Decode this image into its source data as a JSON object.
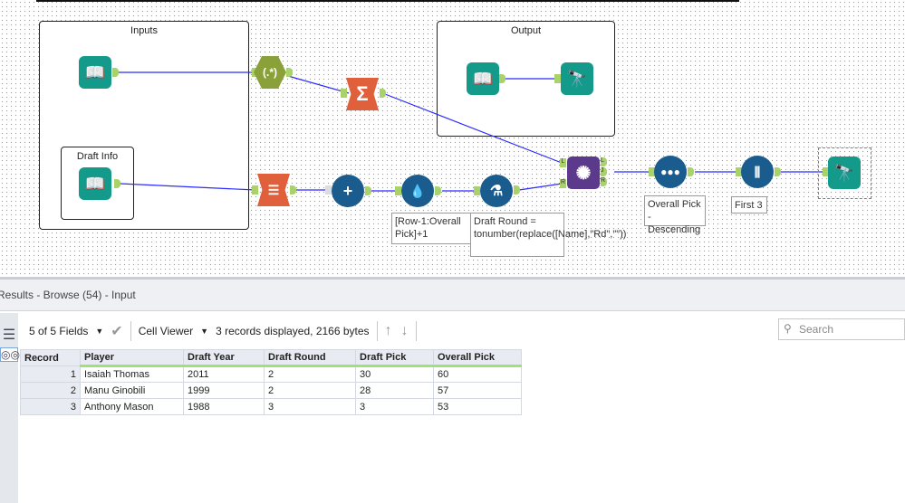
{
  "canvas": {
    "containers": {
      "inputs": "Inputs",
      "output": "Output",
      "draft_info": "Draft Info"
    },
    "tools": {
      "regex": "(.*)",
      "summarize": "Σ",
      "join_left": "L",
      "join_right": "R",
      "join_out_l": "L",
      "join_out_j": "J",
      "join_out_r": "R"
    },
    "annotations": {
      "multirow": "[Row-1:Overall Pick]+1",
      "formula": "Draft Round = tonumber(replace([Name],\"Rd\",\"\"))",
      "sort": "Overall Pick - Descending",
      "sample": "First 3"
    },
    "wire_color": "#2b2bff"
  },
  "results": {
    "title": "Results - Browse (54) - Input",
    "fields": "5 of 5 Fields",
    "viewer": "Cell Viewer",
    "status": "3 records displayed, 2166 bytes",
    "search_placeholder": "Search",
    "columns": [
      "Record",
      "Player",
      "Draft Year",
      "Draft Round",
      "Draft Pick",
      "Overall Pick"
    ],
    "rows": [
      [
        "1",
        "Isaiah Thomas",
        "2011",
        "2",
        "30",
        "60"
      ],
      [
        "2",
        "Manu Ginobili",
        "1999",
        "2",
        "28",
        "57"
      ],
      [
        "3",
        "Anthony Mason",
        "1988",
        "3",
        "3",
        "53"
      ]
    ]
  }
}
